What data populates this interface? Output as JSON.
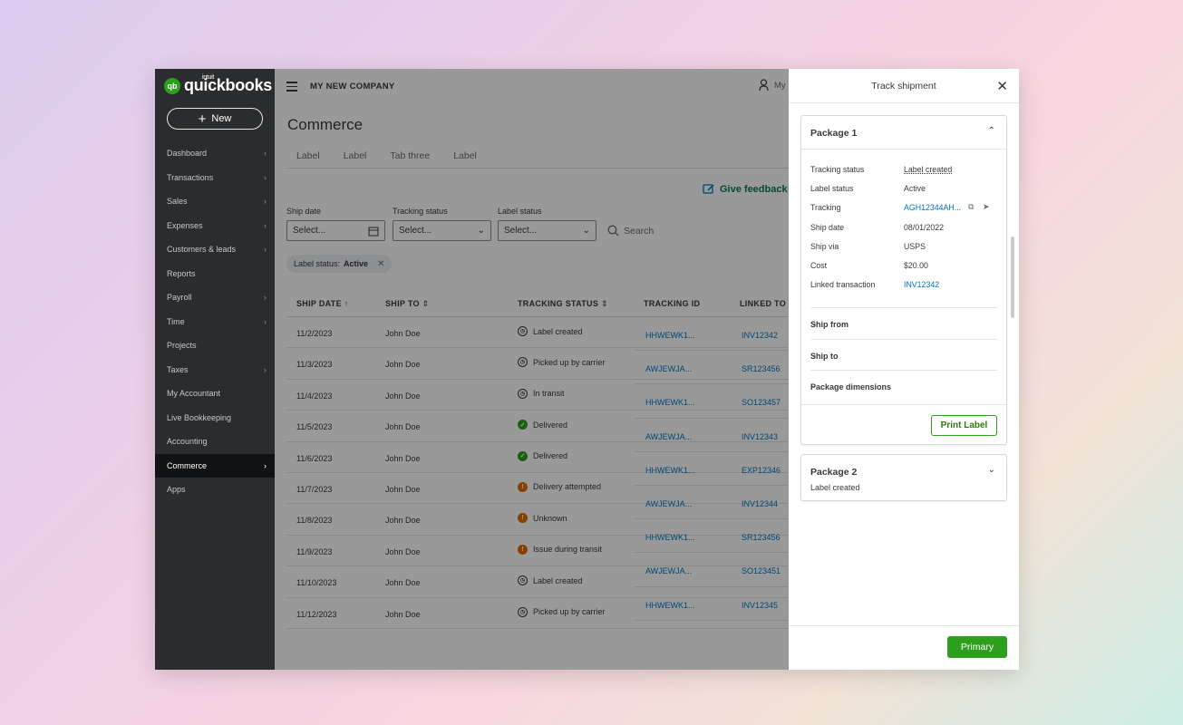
{
  "brand": {
    "intuit": "intuit",
    "name": "quickbooks",
    "badge": "qb"
  },
  "new_button": {
    "label": "New",
    "icon": "plus-icon"
  },
  "sidebar": {
    "items": [
      {
        "label": "Dashboard",
        "chevron": true
      },
      {
        "label": "Transactions",
        "chevron": true
      },
      {
        "label": "Sales",
        "chevron": true
      },
      {
        "label": "Expenses",
        "chevron": true
      },
      {
        "label": "Customers & leads",
        "chevron": true
      },
      {
        "label": "Reports",
        "chevron": false
      },
      {
        "label": "Payroll",
        "chevron": true
      },
      {
        "label": "Time",
        "chevron": true
      },
      {
        "label": "Projects",
        "chevron": false
      },
      {
        "label": "Taxes",
        "chevron": true
      },
      {
        "label": "My Accountant",
        "chevron": false
      },
      {
        "label": "Live Bookkeeping",
        "chevron": false
      },
      {
        "label": "Accounting",
        "chevron": false
      },
      {
        "label": "Commerce",
        "chevron": true,
        "active": true
      },
      {
        "label": "Apps",
        "chevron": false
      }
    ]
  },
  "topbar": {
    "company": "MY NEW COMPANY",
    "user": "My"
  },
  "page": {
    "title": "Commerce",
    "tabs": [
      "Label",
      "Label",
      "Tab three",
      "Label"
    ],
    "feedback": "Give feedback"
  },
  "filters": {
    "ship_date": {
      "label": "Ship date",
      "placeholder": "Select..."
    },
    "tracking_status": {
      "label": "Tracking status",
      "placeholder": "Select..."
    },
    "label_status": {
      "label": "Label status",
      "placeholder": "Select..."
    },
    "search": "Search"
  },
  "chip": {
    "key": "Label status:",
    "value": "Active"
  },
  "table": {
    "headers": [
      "SHIP DATE",
      "SHIP TO",
      "TRACKING STATUS",
      "TRACKING ID",
      "LINKED TO"
    ],
    "rows": [
      {
        "date": "11/2/2023",
        "to": "John Doe",
        "status": "Label created",
        "icon": "clock"
      },
      {
        "date": "11/3/2023",
        "to": "John Doe",
        "status": "Picked up by carrier",
        "icon": "clock"
      },
      {
        "date": "11/4/2023",
        "to": "John Doe",
        "status": "In transit",
        "icon": "clock"
      },
      {
        "date": "11/5/2023",
        "to": "John Doe",
        "status": "Delivered",
        "icon": "ok"
      },
      {
        "date": "11/6/2023",
        "to": "John Doe",
        "status": "Delivered",
        "icon": "ok"
      },
      {
        "date": "11/7/2023",
        "to": "John Doe",
        "status": "Delivery attempted",
        "icon": "warn"
      },
      {
        "date": "11/8/2023",
        "to": "John Doe",
        "status": "Unknown",
        "icon": "warn"
      },
      {
        "date": "11/9/2023",
        "to": "John Doe",
        "status": "Issue during transit",
        "icon": "warn"
      },
      {
        "date": "11/10/2023",
        "to": "John Doe",
        "status": "Label created",
        "icon": "clock"
      },
      {
        "date": "11/12/2023",
        "to": "John Doe",
        "status": "Picked up by carrier",
        "icon": "clock"
      }
    ],
    "tracking": [
      {
        "id": "HHWEWK1...",
        "linked": "INV12342"
      },
      {
        "id": "AWJEWJA...",
        "linked": "SR123456"
      },
      {
        "id": "HHWEWK1...",
        "linked": "SO123457"
      },
      {
        "id": "AWJEWJA...",
        "linked": "INV12343"
      },
      {
        "id": "HHWEWK1...",
        "linked": "EXP12346"
      },
      {
        "id": "AWJEWJA...",
        "linked": "INV12344"
      },
      {
        "id": "HHWEWK1...",
        "linked": "SR123456"
      },
      {
        "id": "AWJEWJA...",
        "linked": "SO123451"
      },
      {
        "id": "HHWEWK1...",
        "linked": "INV12345"
      }
    ]
  },
  "drawer": {
    "title": "Track shipment",
    "package1": {
      "title": "Package 1",
      "fields": [
        {
          "k": "Tracking status",
          "v": "Label created",
          "style": "underline"
        },
        {
          "k": "Label status",
          "v": "Active",
          "style": "plain"
        },
        {
          "k": "Tracking",
          "v": "AGH12344AH...",
          "style": "link"
        },
        {
          "k": "Ship date",
          "v": "08/01/2022",
          "style": "plain"
        },
        {
          "k": "Ship via",
          "v": "USPS",
          "style": "plain"
        },
        {
          "k": "Cost",
          "v": "$20.00",
          "style": "plain"
        },
        {
          "k": "Linked transaction",
          "v": "INV12342",
          "style": "link"
        }
      ],
      "sections": [
        "Ship from",
        "Ship to",
        "Package dimensions"
      ],
      "print": "Print Label"
    },
    "package2": {
      "title": "Package 2",
      "subtitle": "Label created"
    },
    "primary": "Primary"
  },
  "colors": {
    "accent": "#2ca01c",
    "link": "#0077c5",
    "sidebar": "#2b2c2e",
    "warn": "#e06b00"
  }
}
